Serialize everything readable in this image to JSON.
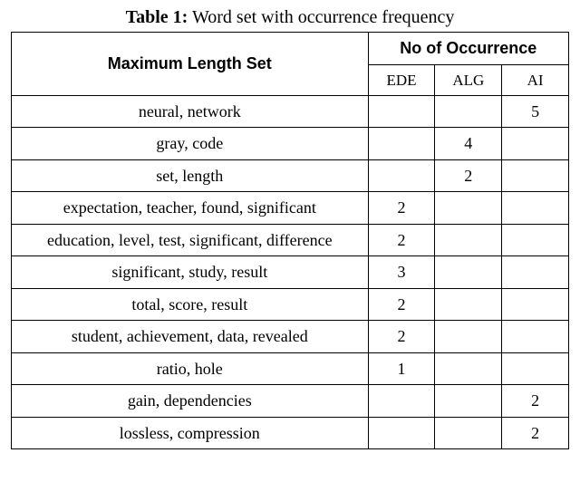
{
  "caption": {
    "label": "Table 1:",
    "text": "Word set with occurrence frequency"
  },
  "header": {
    "colA": "Maximum Length Set",
    "colB": "No of Occurrence"
  },
  "sub": {
    "c1": "EDE",
    "c2": "ALG",
    "c3": "AI"
  },
  "rows": {
    "r0": {
      "set": "neural, network",
      "ede": "",
      "alg": "",
      "ai": "5"
    },
    "r1": {
      "set": "gray, code",
      "ede": "",
      "alg": "4",
      "ai": ""
    },
    "r2": {
      "set": "set, length",
      "ede": "",
      "alg": "2",
      "ai": ""
    },
    "r3": {
      "set": "expectation, teacher, found,  significant",
      "ede": "2",
      "alg": "",
      "ai": ""
    },
    "r4": {
      "set": "education, level, test,  significant, difference",
      "ede": "2",
      "alg": "",
      "ai": ""
    },
    "r5": {
      "set": "significant, study, result",
      "ede": "3",
      "alg": "",
      "ai": ""
    },
    "r6": {
      "set": "total, score, result",
      "ede": "2",
      "alg": "",
      "ai": ""
    },
    "r7": {
      "set": "student, achievement, data, revealed",
      "ede": "2",
      "alg": "",
      "ai": ""
    },
    "r8": {
      "set": "ratio, hole",
      "ede": "1",
      "alg": "",
      "ai": ""
    },
    "r9": {
      "set": "gain, dependencies",
      "ede": "",
      "alg": "",
      "ai": "2"
    },
    "r10": {
      "set": "lossless, compression",
      "ede": "",
      "alg": "",
      "ai": "2"
    }
  },
  "chart_data": {
    "type": "table",
    "title": "Word set with occurrence frequency",
    "columns": [
      "Maximum Length Set",
      "EDE",
      "ALG",
      "AI"
    ],
    "rows": [
      [
        "neural, network",
        null,
        null,
        5
      ],
      [
        "gray, code",
        null,
        4,
        null
      ],
      [
        "set, length",
        null,
        2,
        null
      ],
      [
        "expectation, teacher, found, significant",
        2,
        null,
        null
      ],
      [
        "education, level, test, significant, difference",
        2,
        null,
        null
      ],
      [
        "significant, study, result",
        3,
        null,
        null
      ],
      [
        "total, score, result",
        2,
        null,
        null
      ],
      [
        "student, achievement, data, revealed",
        2,
        null,
        null
      ],
      [
        "ratio, hole",
        1,
        null,
        null
      ],
      [
        "gain, dependencies",
        null,
        null,
        2
      ],
      [
        "lossless, compression",
        null,
        null,
        2
      ]
    ]
  }
}
